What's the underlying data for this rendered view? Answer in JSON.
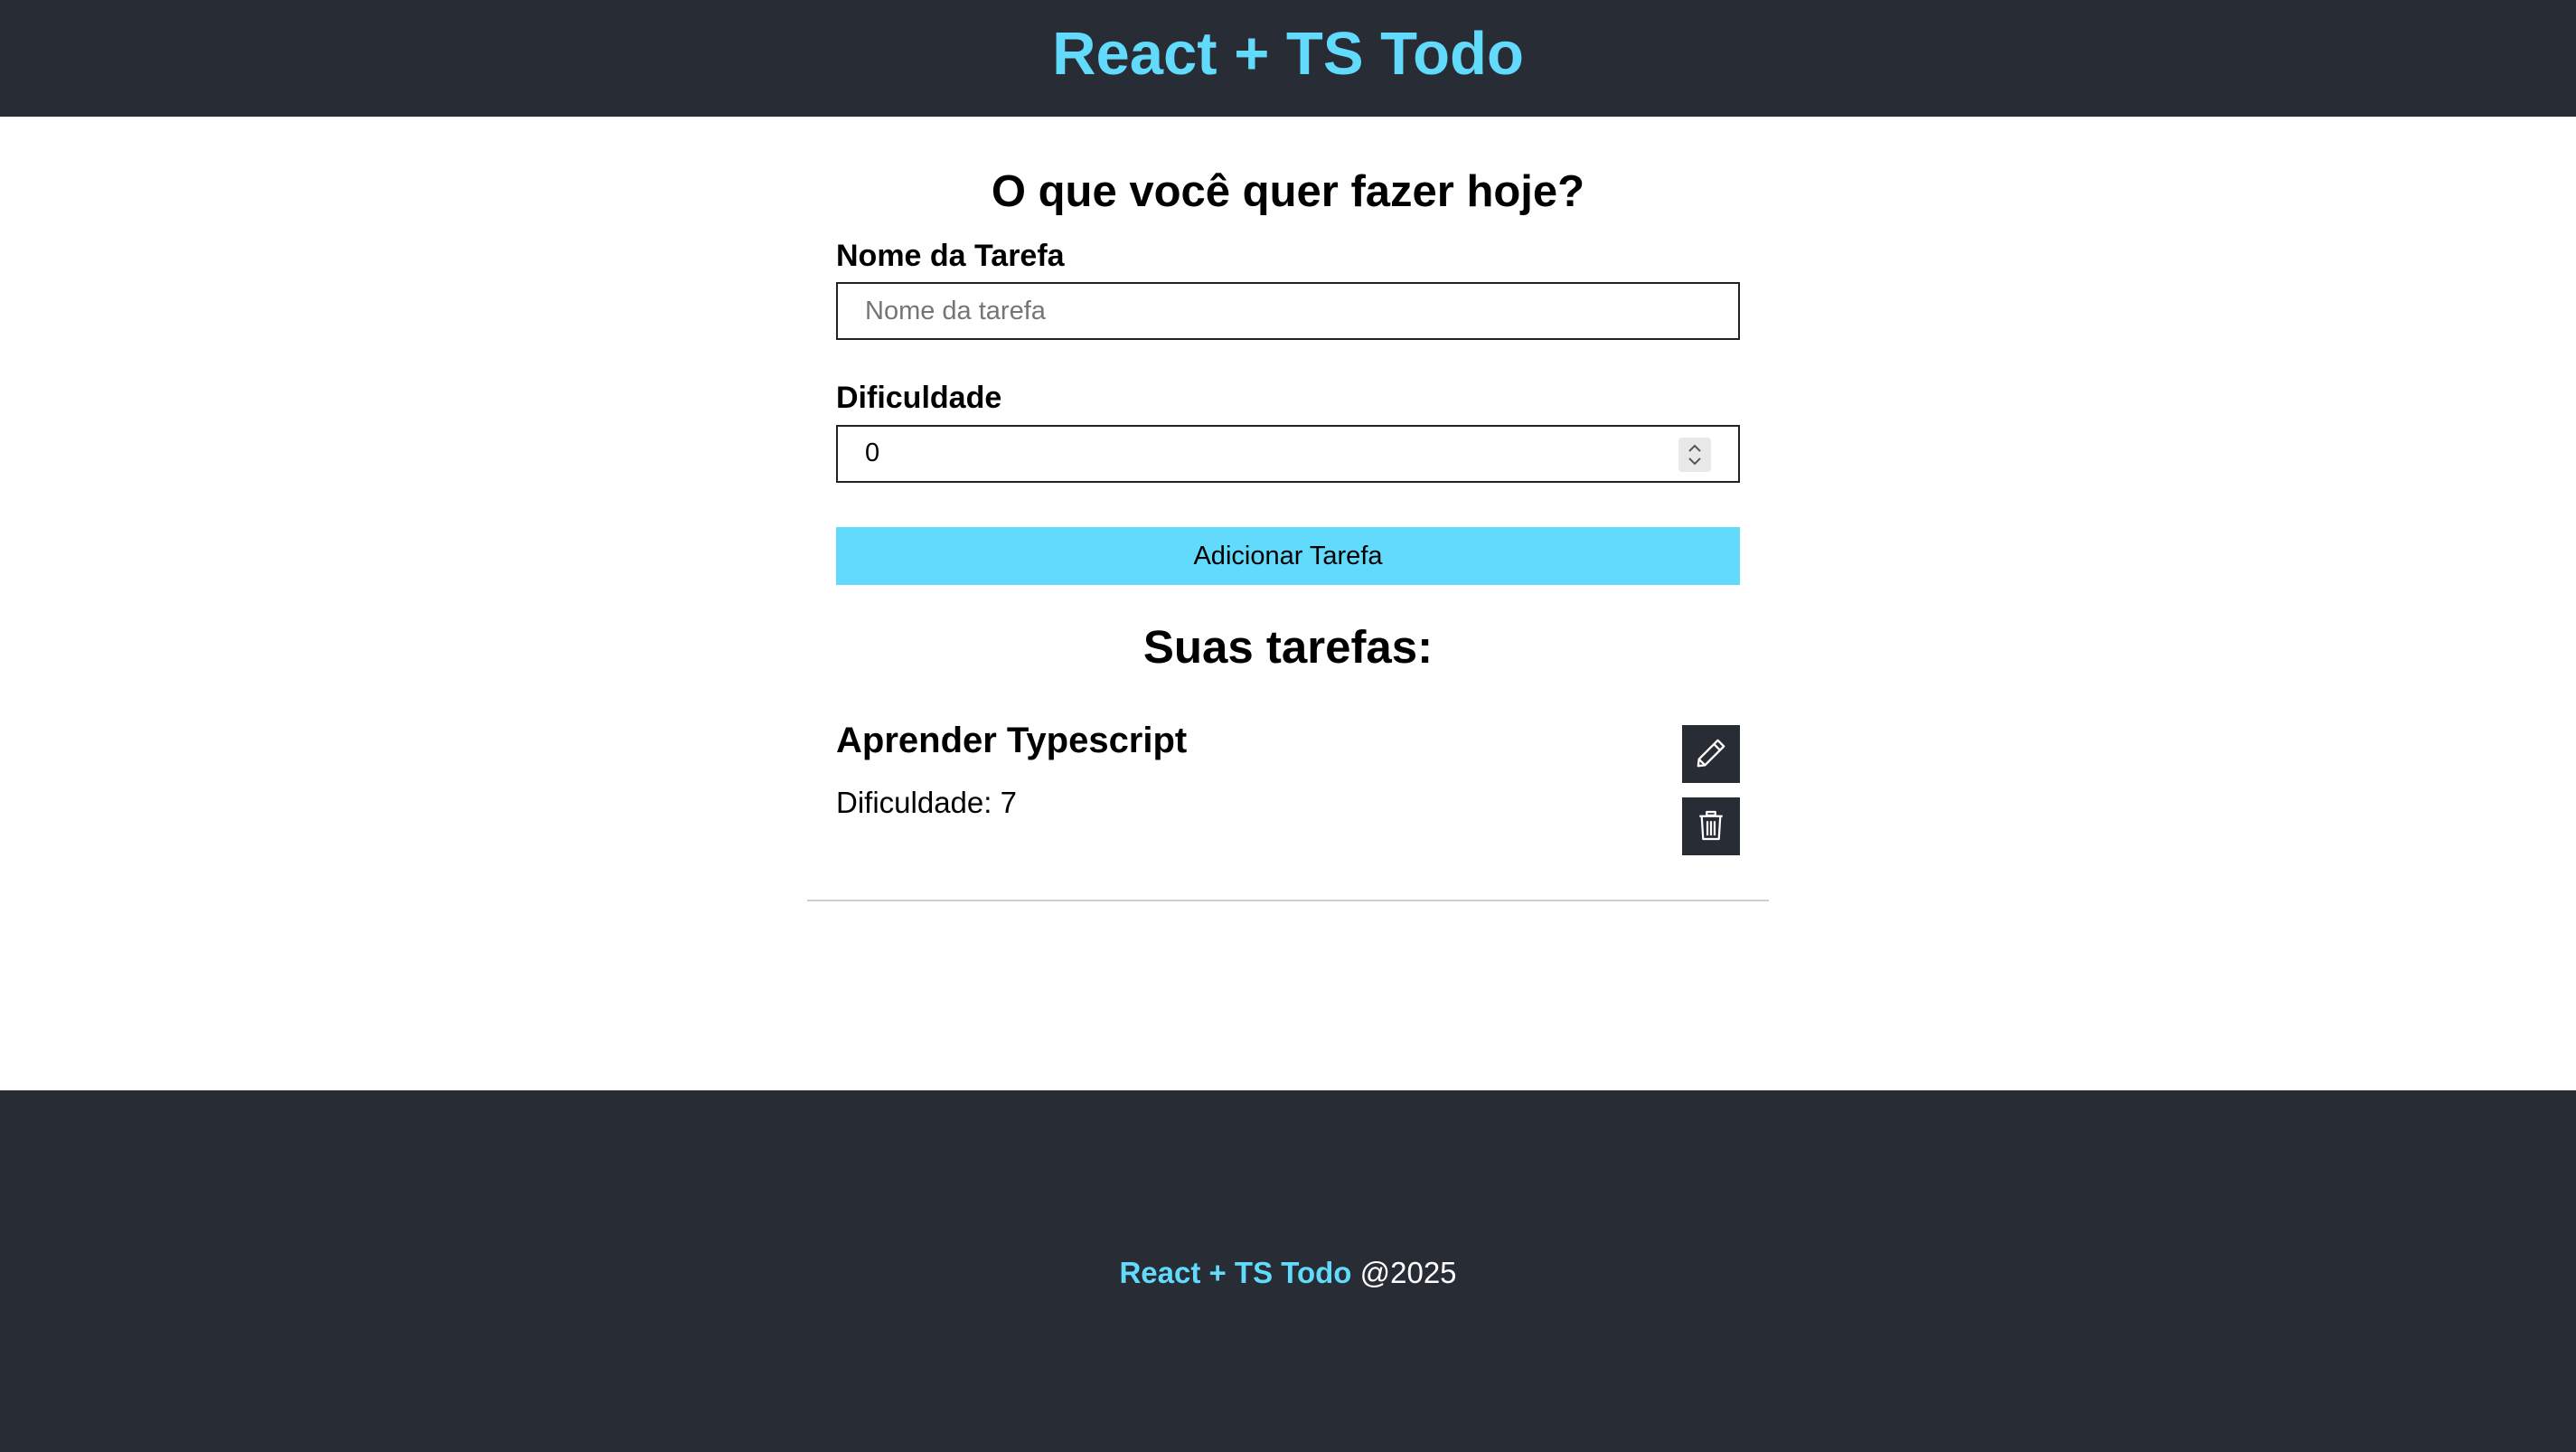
{
  "header": {
    "title": "React + TS Todo"
  },
  "form": {
    "title": "O que você quer fazer hoje?",
    "name_label": "Nome da Tarefa",
    "name_placeholder": "Nome da tarefa",
    "name_value": "",
    "difficulty_label": "Dificuldade",
    "difficulty_value": "0",
    "submit_label": "Adicionar Tarefa"
  },
  "list": {
    "title": "Suas tarefas:",
    "tasks": [
      {
        "name": "Aprender Typescript",
        "difficulty_text": "Dificuldade: 7",
        "edit_icon": "pencil-icon",
        "delete_icon": "trash-icon"
      }
    ]
  },
  "footer": {
    "brand": "React + TS Todo",
    "year": "@2025"
  },
  "colors": {
    "dark_bg": "#282c34",
    "accent": "#61dafb"
  }
}
